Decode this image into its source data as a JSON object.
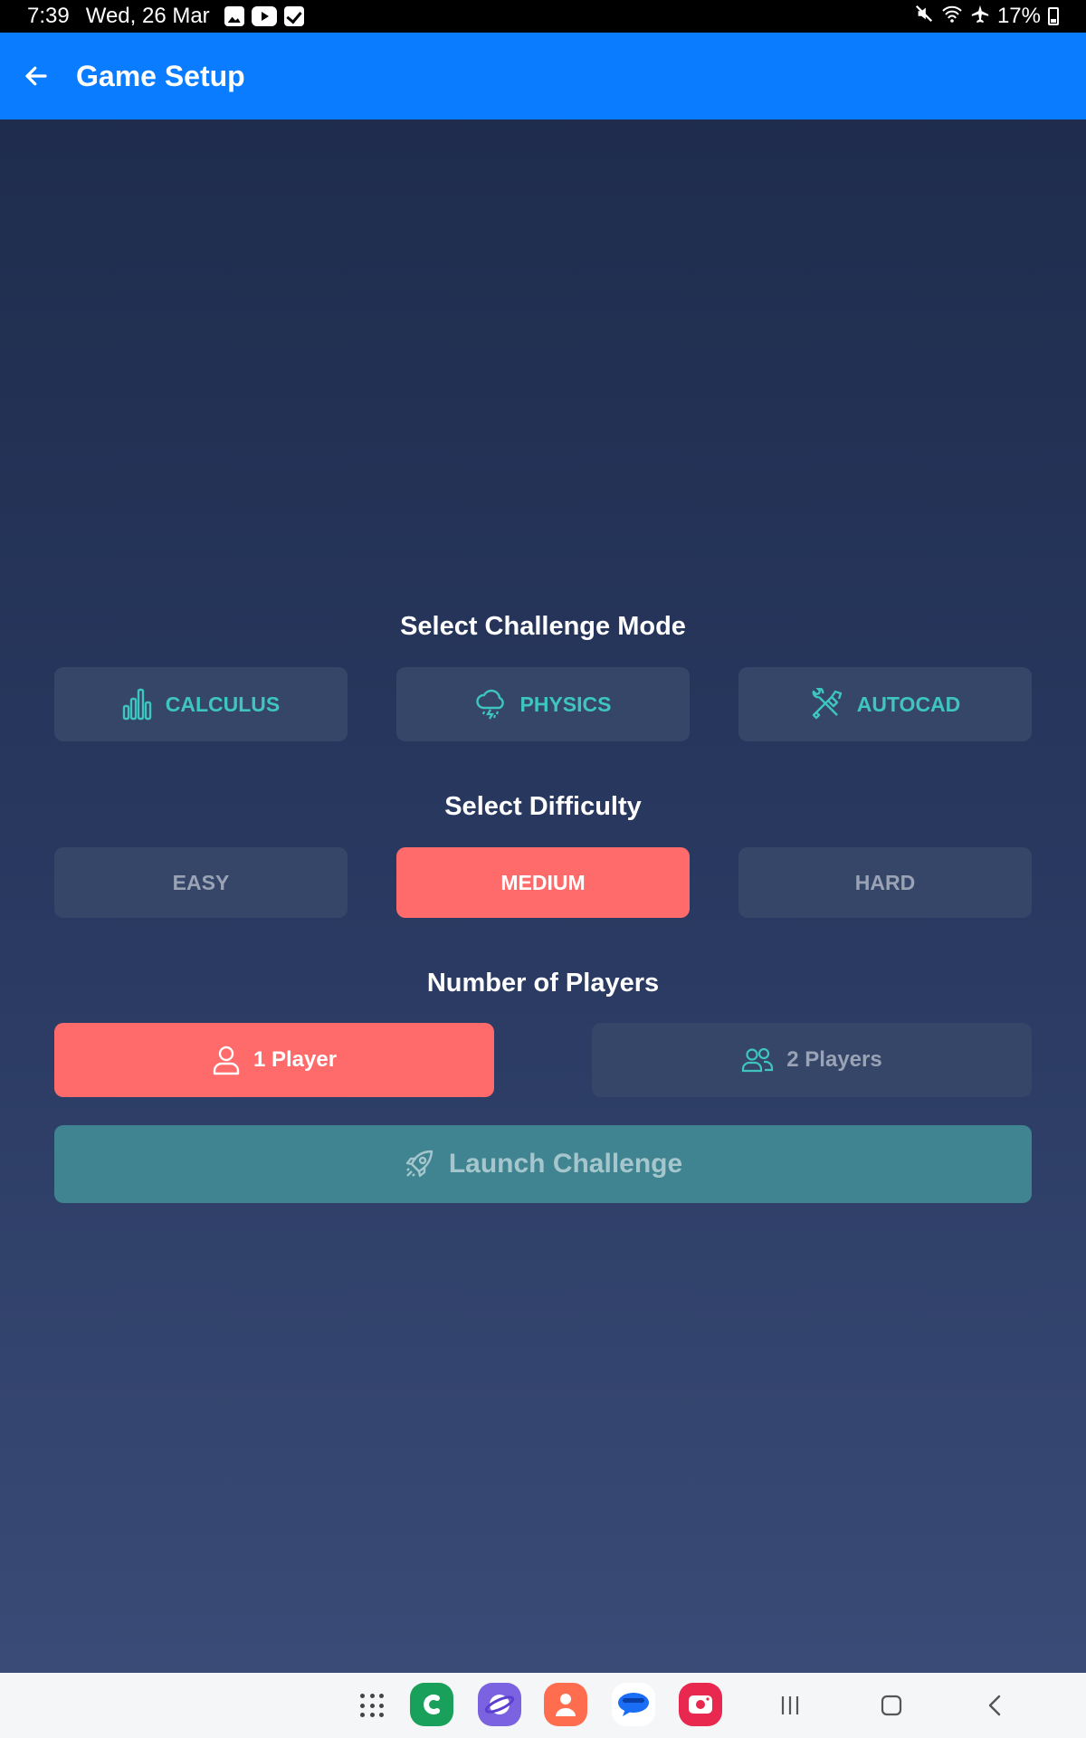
{
  "status_bar": {
    "time": "7:39",
    "date": "Wed, 26 Mar",
    "battery": "17%"
  },
  "app_bar": {
    "title": "Game Setup"
  },
  "challenge_mode": {
    "title": "Select Challenge Mode",
    "options": [
      {
        "label": "CALCULUS",
        "icon": "bar-chart-icon"
      },
      {
        "label": "PHYSICS",
        "icon": "storm-cloud-icon"
      },
      {
        "label": "AUTOCAD",
        "icon": "tools-icon"
      }
    ]
  },
  "difficulty": {
    "title": "Select Difficulty",
    "options": [
      {
        "label": "EASY",
        "selected": false
      },
      {
        "label": "MEDIUM",
        "selected": true
      },
      {
        "label": "HARD",
        "selected": false
      }
    ]
  },
  "players": {
    "title": "Number of Players",
    "options": [
      {
        "label": "1 Player",
        "icon": "user-icon",
        "selected": true
      },
      {
        "label": "2 Players",
        "icon": "users-icon",
        "selected": false
      }
    ]
  },
  "launch": {
    "label": "Launch Challenge",
    "icon": "rocket-icon"
  },
  "colors": {
    "app_bar": "#0a7cff",
    "accent_selected": "#ff6b6b",
    "teal": "#3ec5c0",
    "launch": "#3f8490"
  }
}
